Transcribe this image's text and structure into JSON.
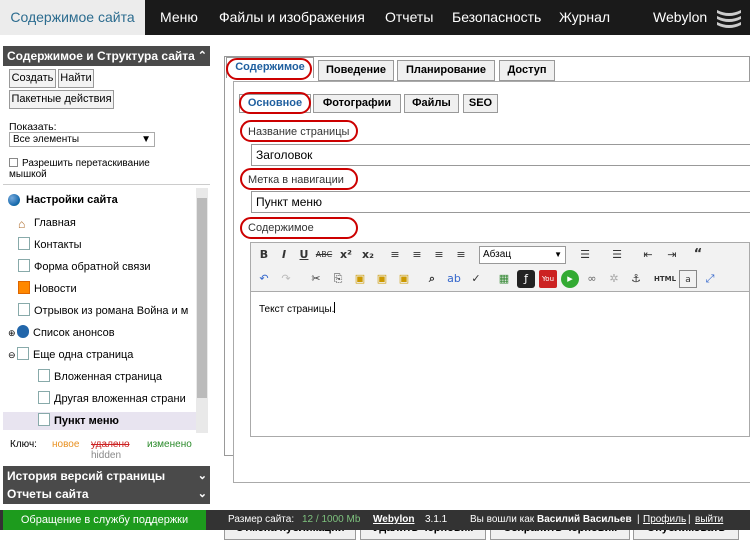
{
  "nav": {
    "active": "Содержимое сайта",
    "items": [
      "Меню",
      "Файлы и изображения",
      "Отчеты",
      "Безопасность",
      "Журнал"
    ],
    "brand": "Webylon"
  },
  "sidebar": {
    "title": "Содержимое и Структура сайта",
    "create": "Создать",
    "find": "Найти",
    "batch": "Пакетные действия",
    "show_label": "Показать:",
    "show_value": "Все элементы",
    "drag_label": "Разрешить перетаскивание мышкой",
    "tree_root": "Настройки сайта",
    "tree": [
      "Главная",
      "Контакты",
      "Форма обратной связи",
      "Новости",
      "Отрывок из романа Война и м",
      "Список анонсов",
      "Еще одна страница",
      "Вложенная страница",
      "Другая вложенная страни",
      "Пункт меню"
    ],
    "key_label": "Ключ:",
    "key_new": "новое",
    "key_deleted": "удалено",
    "key_changed": "изменено",
    "key_hidden": "hidden",
    "history": "История версий страницы",
    "reports": "Отчеты сайта"
  },
  "tabs": [
    "Содержимое",
    "Поведение",
    "Планирование",
    "Доступ"
  ],
  "subtabs": [
    "Основное",
    "Фотографии",
    "Файлы",
    "SEO"
  ],
  "fields": {
    "title_label": "Название страницы",
    "title_value": "Заголовок",
    "nav_label": "Метка в навигации",
    "nav_value": "Пункт меню",
    "content_label": "Содержимое",
    "format_select": "Абзац",
    "content_text": "Текст страницы."
  },
  "actions": [
    "Отмена публикации",
    "Удалить черновик",
    "Сохранить черновик",
    "Опубликовать"
  ],
  "footer": {
    "support": "Обращение в службу поддержки",
    "size_label": "Размер сайта:",
    "size_value": "12 / 1000 Mb",
    "brand": "Webylon",
    "version": "3.1.1",
    "login_text": "Вы вошли как",
    "user": "Василий Васильев",
    "profile": "Профиль",
    "logout": "выйти"
  }
}
